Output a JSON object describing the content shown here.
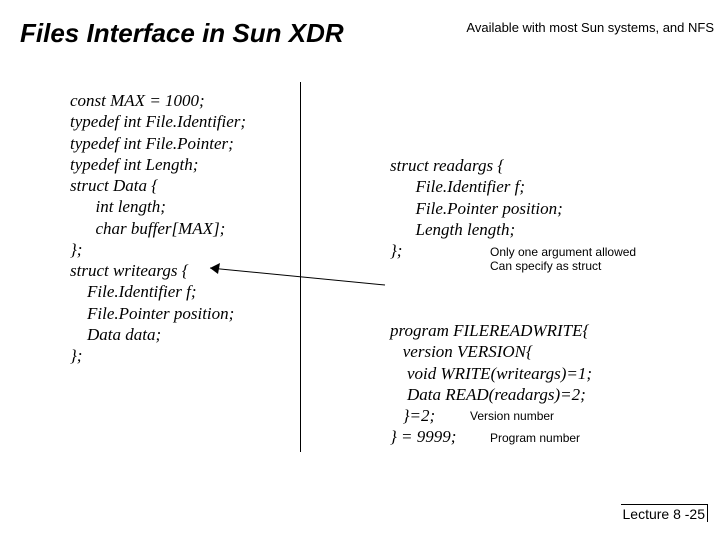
{
  "title": "Files Interface in Sun XDR",
  "avail": "Available with most Sun systems, and NFS",
  "left": {
    "l0": "const MAX = 1000;",
    "l1": "typedef int File.Identifier;",
    "l2": "typedef int File.Pointer;",
    "l3": "typedef int Length;",
    "l4": "struct Data {",
    "l5": "      int length;",
    "l6": "      char buffer[MAX];",
    "l7": "};",
    "l8": "struct writeargs {",
    "l9": "    File.Identifier f;",
    "l10": "    File.Pointer position;",
    "l11": "    Data data;",
    "l12": "};"
  },
  "right_struct": {
    "l0": "struct readargs {",
    "l1": "      File.Identifier f;",
    "l2": "      File.Pointer position;",
    "l3": "      Length length;",
    "l4": "};"
  },
  "right_prog": {
    "l0": "program FILEREADWRITE{",
    "l1": "   version VERSION{",
    "l2": "    void WRITE(writeargs)=1;",
    "l3": "    Data READ(readargs)=2;",
    "l4": "   }=2;",
    "l5": "} = 9999;"
  },
  "notes": {
    "n1a": "Only one argument allowed",
    "n1b": "Can specify as struct",
    "n2": "Version number",
    "n3": "Program number"
  },
  "footer": "Lecture 8 -25"
}
